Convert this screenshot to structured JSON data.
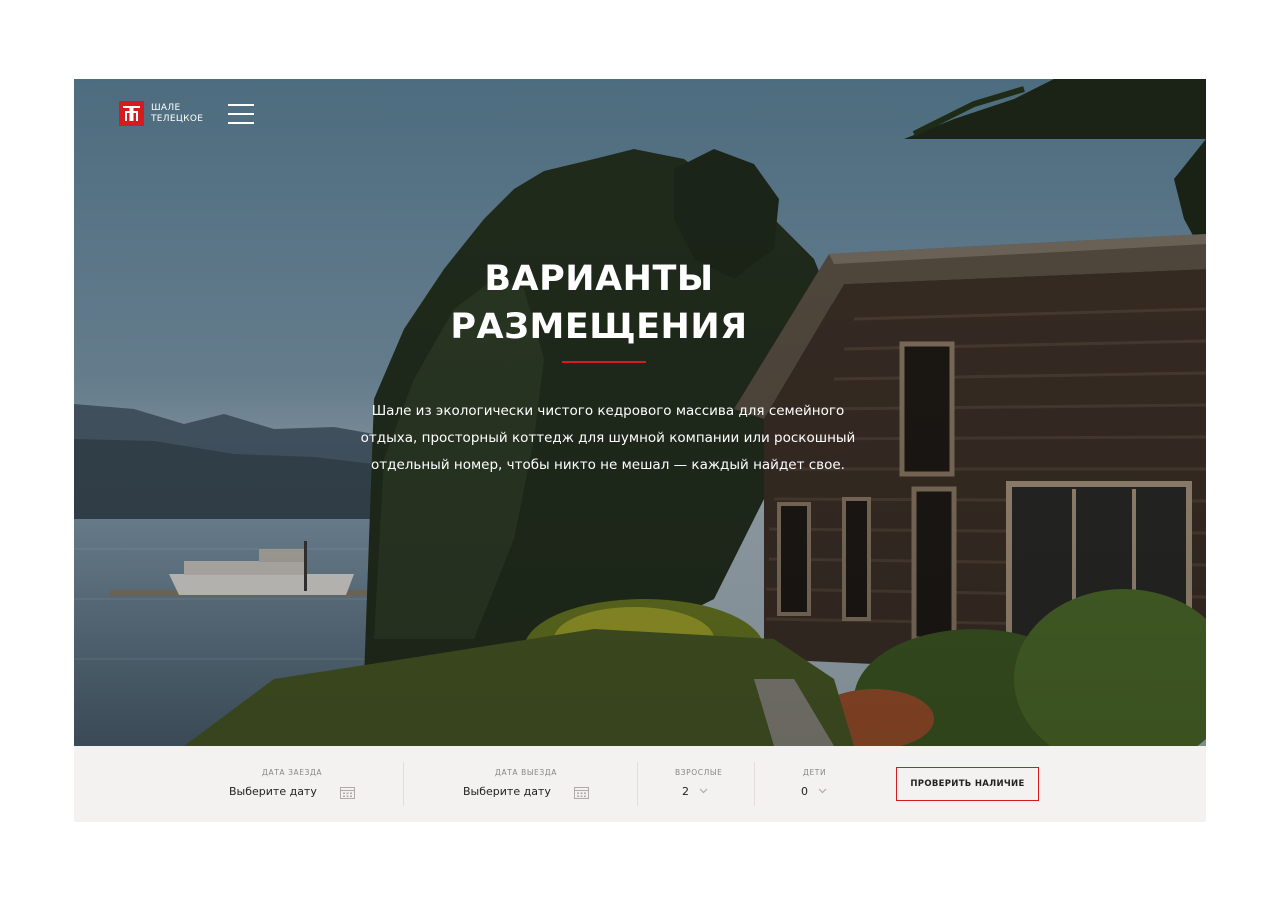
{
  "brand": {
    "line1": "ШАЛЕ",
    "line2": "ТЕЛЕЦКОЕ",
    "accent_color": "#d71920"
  },
  "hero": {
    "title_line1": "ВАРИАНТЫ",
    "title_line2": "РАЗМЕЩЕНИЯ",
    "description": "Шале из экологически чистого кедрового массива для семейного отдыха, просторный коттедж для шумной компании или роскошный отдельный номер, чтобы никто не мешал — каждый найдет свое.",
    "image": "lakeside log chalet among pine trees with a boat on the lake"
  },
  "booking": {
    "checkin": {
      "label": "ДАТА ЗАЕЗДА",
      "value": "Выберите дату",
      "icon": "calendar-icon"
    },
    "checkout": {
      "label": "ДАТА ВЫЕЗДА",
      "value": "Выберите дату",
      "icon": "calendar-icon"
    },
    "adults": {
      "label": "ВЗРОСЛЫЕ",
      "value": "2"
    },
    "children": {
      "label": "ДЕТИ",
      "value": "0"
    },
    "submit_label": "ПРОВЕРИТЬ НАЛИЧИЕ"
  }
}
